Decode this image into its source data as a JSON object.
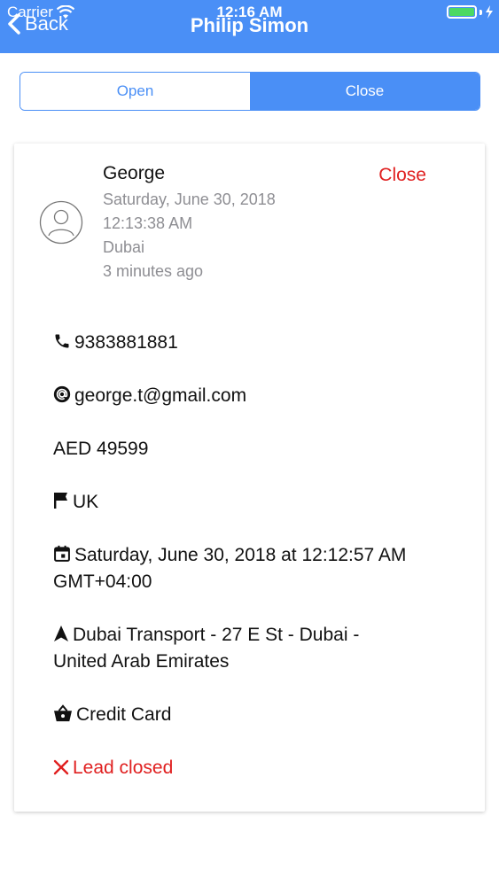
{
  "status_bar": {
    "carrier": "Carrier",
    "time": "12:16 AM"
  },
  "nav": {
    "back_label": "Back",
    "title": "Philip Simon"
  },
  "segments": {
    "open_label": "Open",
    "close_label": "Close",
    "selected": "Close"
  },
  "lead": {
    "name": "George",
    "date": "Saturday, June 30, 2018",
    "time": "12:13:38 AM",
    "city": "Dubai",
    "relative_time": "3 minutes ago",
    "status_action": "Close",
    "phone": "9383881881",
    "email": "george.t@gmail.com",
    "amount": "AED 49599",
    "country": "UK",
    "datetime_line1": "Saturday, June 30, 2018 at 12:12:57 AM",
    "datetime_line2": "GMT+04:00",
    "address_line1": "Dubai Transport - 27 E St - Dubai -",
    "address_line2": "United Arab Emirates",
    "payment": "Credit Card",
    "closed_status": "Lead closed"
  },
  "colors": {
    "accent": "#4a8ff6",
    "danger": "#e02020",
    "muted_text": "#8e8e93"
  },
  "icons": [
    "wifi-icon",
    "battery-icon",
    "charging-icon",
    "chevron-left-icon",
    "user-avatar-icon",
    "phone-icon",
    "at-icon",
    "flag-icon",
    "calendar-icon",
    "navigation-arrow-icon",
    "basket-icon",
    "close-x-icon"
  ]
}
